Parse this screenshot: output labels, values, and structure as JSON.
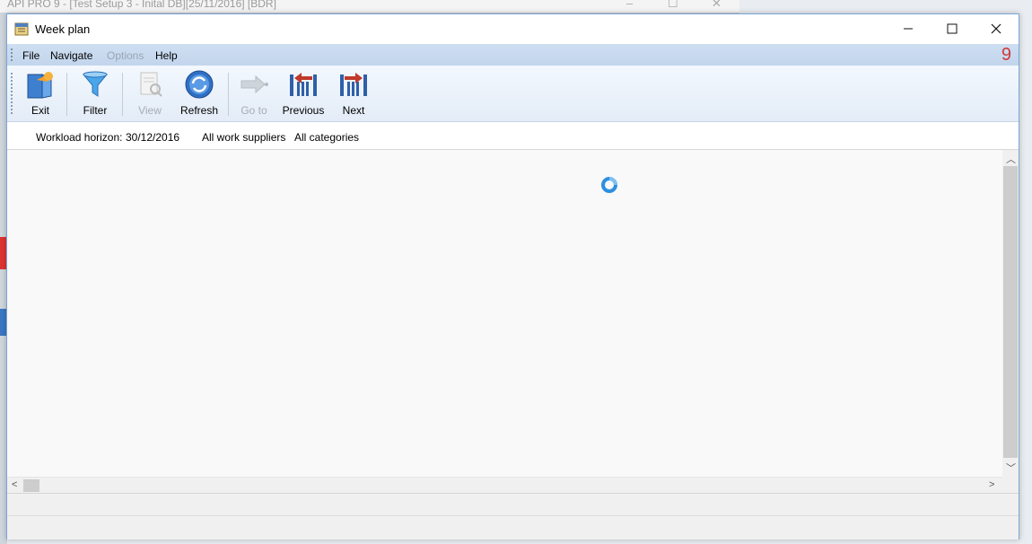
{
  "background_window": {
    "title": "API PRO 9 - [Test Setup 3 - Inital DB][25/11/2016] [BDR]"
  },
  "window": {
    "title": "Week plan",
    "icon": "week-plan-icon",
    "controls": {
      "minimize_icon": "minimize-icon",
      "maximize_icon": "maximize-icon",
      "close_icon": "close-icon"
    }
  },
  "menubar": {
    "items": [
      {
        "label": "File",
        "enabled": true
      },
      {
        "label": "Navigate",
        "enabled": true
      },
      {
        "label": "Options",
        "enabled": false
      },
      {
        "label": "Help",
        "enabled": true
      }
    ],
    "brand": "9"
  },
  "toolbar": {
    "buttons": [
      {
        "label": "Exit",
        "icon": "exit-icon",
        "enabled": true
      },
      {
        "label": "Filter",
        "icon": "filter-icon",
        "enabled": true
      },
      {
        "label": "View",
        "icon": "view-icon",
        "enabled": false
      },
      {
        "label": "Refresh",
        "icon": "refresh-icon",
        "enabled": true
      },
      {
        "label": "Go to",
        "icon": "goto-icon",
        "enabled": false
      },
      {
        "label": "Previous",
        "icon": "previous-icon",
        "enabled": true
      },
      {
        "label": "Next",
        "icon": "next-icon",
        "enabled": true
      }
    ]
  },
  "info": {
    "workload_label": "Workload horizon:",
    "workload_value": "30/12/2016",
    "suppliers": "All work suppliers",
    "categories": "All categories"
  },
  "colors": {
    "accent": "#2d8fe0",
    "menubar": "#c9dbef",
    "brand_red": "#d0393a"
  }
}
